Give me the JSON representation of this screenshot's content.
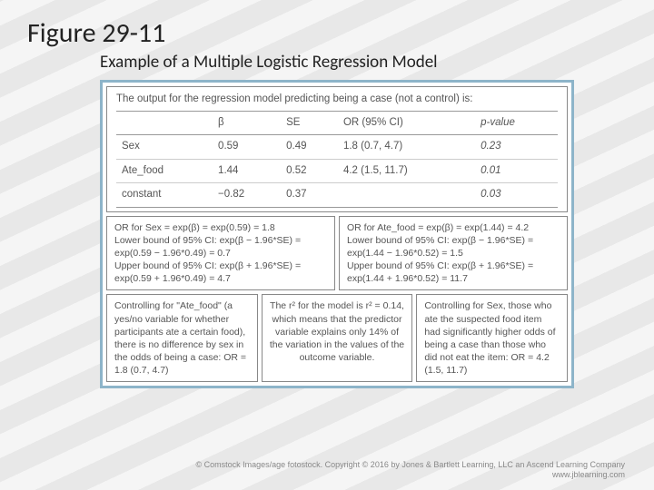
{
  "figure_label": "Figure 29-11",
  "subtitle": "Example of a Multiple Logistic Regression Model",
  "intro": "The output for the regression model predicting being a case (not a control) is:",
  "table": {
    "headers": [
      "",
      "β",
      "SE",
      "OR (95% CI)",
      "p-value"
    ],
    "rows": [
      {
        "name": "Sex",
        "beta": "0.59",
        "se": "0.49",
        "or": "1.8 (0.7, 4.7)",
        "p": "0.23"
      },
      {
        "name": "Ate_food",
        "beta": "1.44",
        "se": "0.52",
        "or": "4.2 (1.5, 11.7)",
        "p": "0.01"
      },
      {
        "name": "constant",
        "beta": "−0.82",
        "se": "0.37",
        "or": "",
        "p": "0.03"
      }
    ]
  },
  "calc_boxes": [
    {
      "l1": "OR for Sex = exp(β) = exp(0.59) = 1.8",
      "l2": "Lower bound of 95% CI: exp(β − 1.96*SE) = exp(0.59 − 1.96*0.49) = 0.7",
      "l3": "Upper bound of 95% CI: exp(β + 1.96*SE) = exp(0.59 + 1.96*0.49) = 4.7"
    },
    {
      "l1": "OR for Ate_food = exp(β) = exp(1.44) = 4.2",
      "l2": "Lower bound of 95% CI: exp(β − 1.96*SE) = exp(1.44 − 1.96*0.52) = 1.5",
      "l3": "Upper bound of 95% CI: exp(β + 1.96*SE) = exp(1.44 + 1.96*0.52) = 11.7"
    }
  ],
  "interp_boxes": [
    "Controlling for \"Ate_food\" (a yes/no variable for whether participants ate a certain food), there is no difference by sex in the odds of being a case: OR = 1.8 (0.7, 4.7)",
    "The r² for the model is r² = 0.14, which means that the predictor variable explains only 14% of the variation in the values of the outcome variable.",
    "Controlling for Sex, those who ate the suspected food item had significantly higher odds of being a case than those who did not eat the item: OR = 4.2 (1.5, 11.7)"
  ],
  "copyright": {
    "l1": "© Comstock Images/age fotostock. Copyright © 2016 by Jones & Bartlett Learning, LLC an Ascend Learning Company",
    "l2": "www.jblearning.com"
  }
}
